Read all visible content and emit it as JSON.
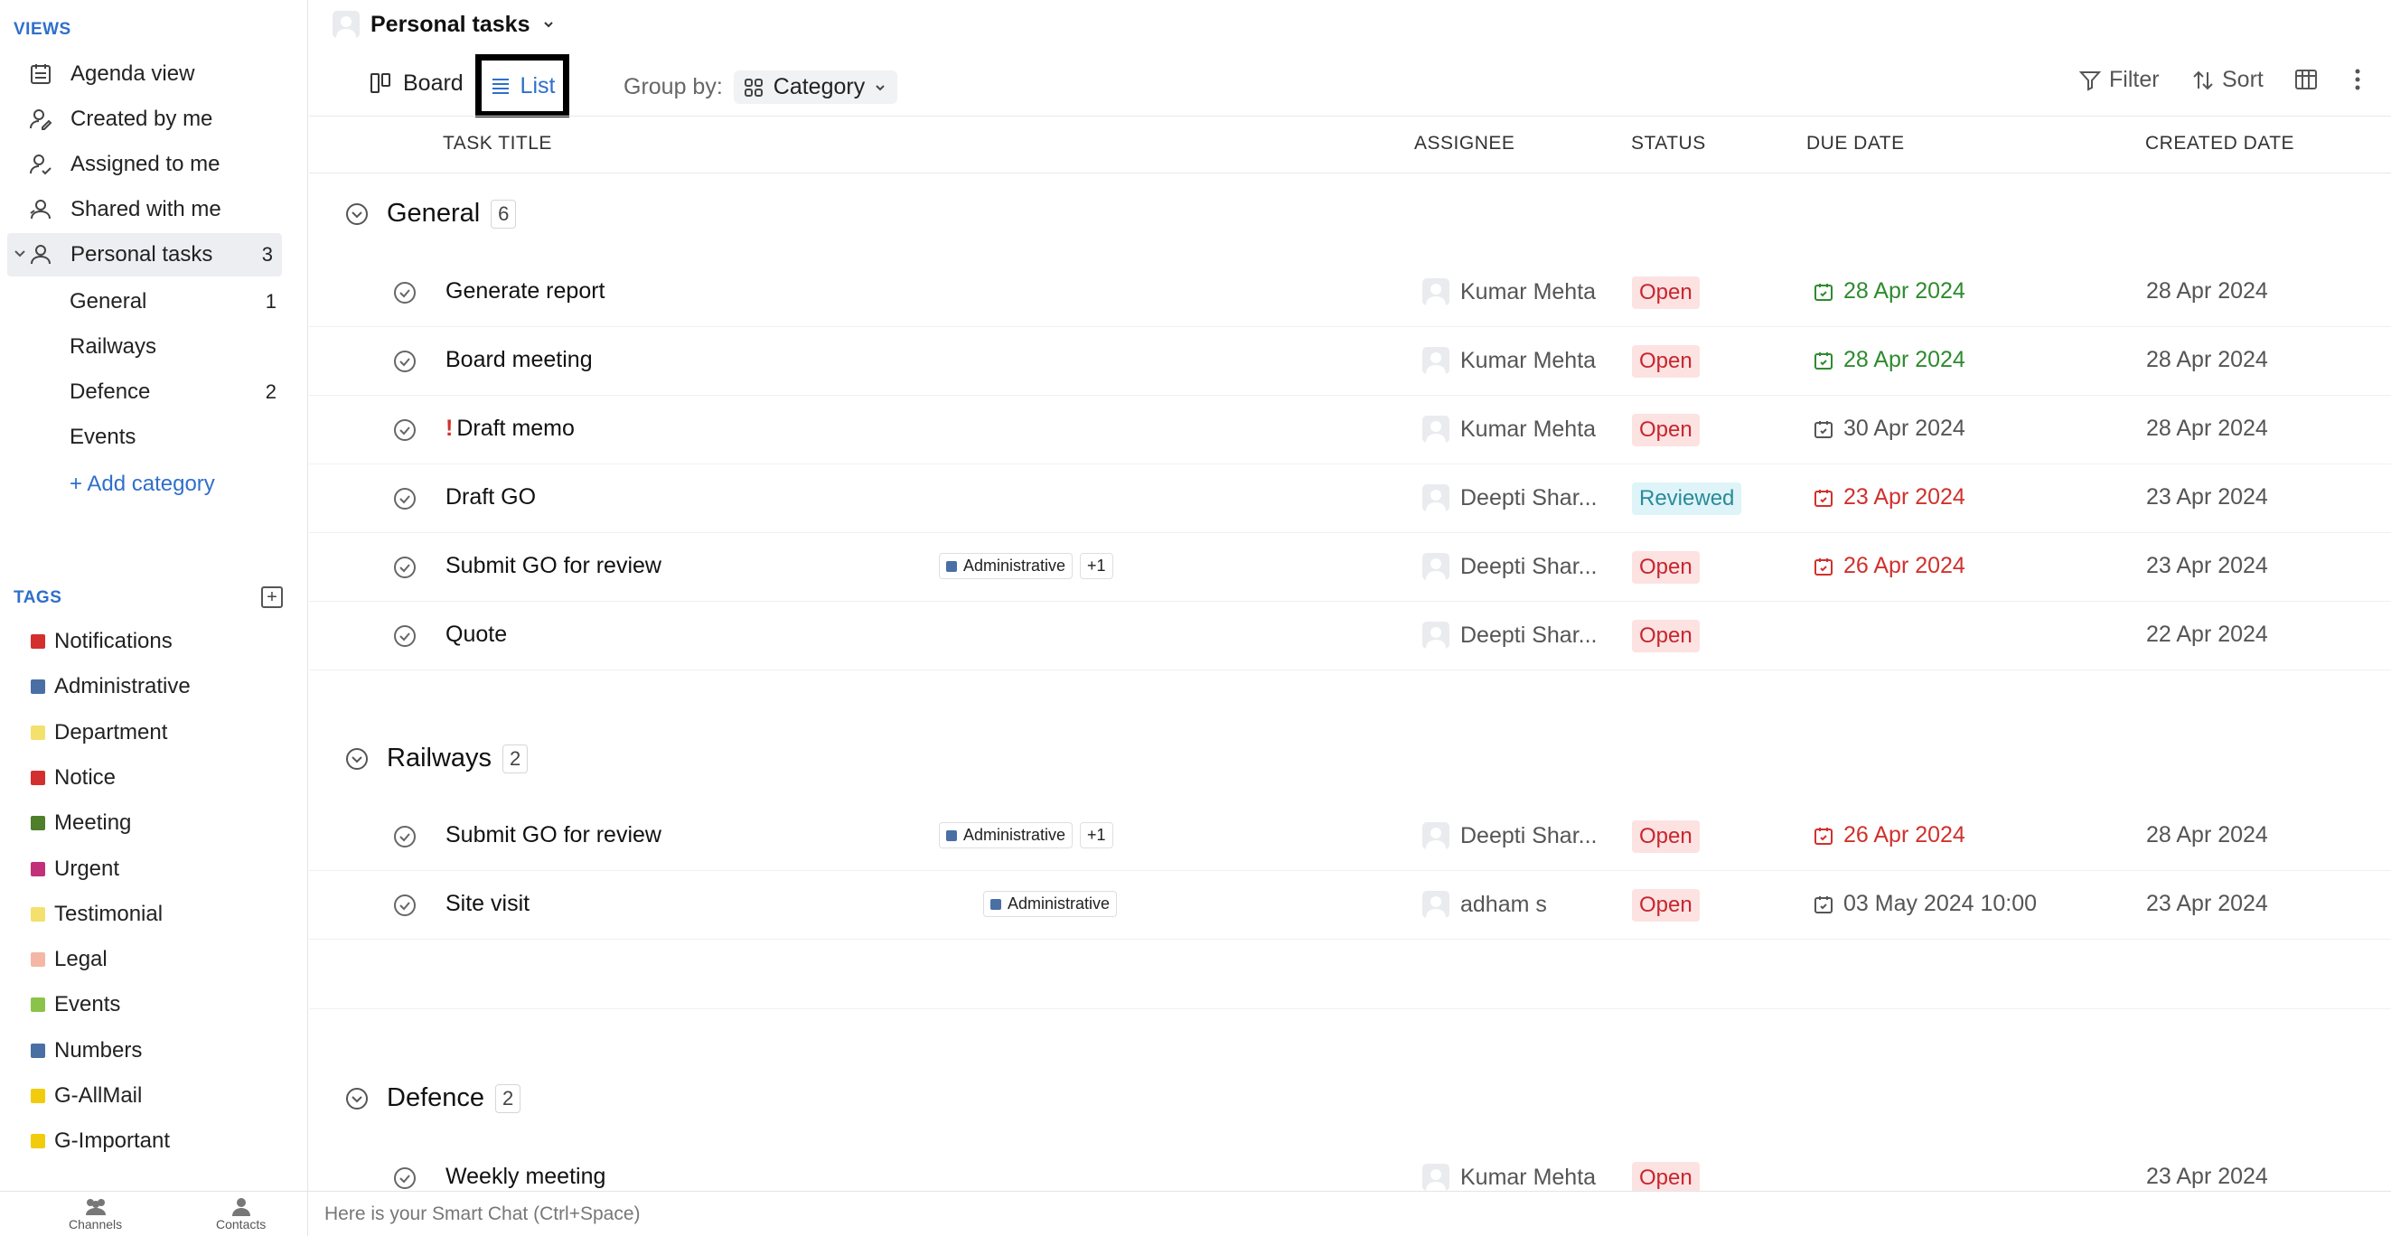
{
  "sidebar": {
    "views_title": "VIEWS",
    "views": [
      {
        "label": "Agenda view",
        "icon": "calendar-list-icon"
      },
      {
        "label": "Created by me",
        "icon": "user-edit-icon"
      },
      {
        "label": "Assigned to me",
        "icon": "user-check-icon"
      },
      {
        "label": "Shared with me",
        "icon": "user-share-icon"
      },
      {
        "label": "Personal tasks",
        "icon": "user-icon",
        "count": "3"
      }
    ],
    "categories": [
      {
        "label": "General",
        "count": "1"
      },
      {
        "label": "Railways",
        "count": ""
      },
      {
        "label": "Defence",
        "count": "2"
      },
      {
        "label": "Events",
        "count": ""
      }
    ],
    "add_category": "+ Add category",
    "tags_title": "TAGS",
    "tags": [
      {
        "label": "Notifications",
        "color": "#d32f2f"
      },
      {
        "label": "Administrative",
        "color": "#4a6fa5"
      },
      {
        "label": "Department",
        "color": "#f4e06d"
      },
      {
        "label": "Notice",
        "color": "#d32f2f"
      },
      {
        "label": "Meeting",
        "color": "#4f7f2a"
      },
      {
        "label": "Urgent",
        "color": "#c2307a"
      },
      {
        "label": "Testimonial",
        "color": "#f4e06d"
      },
      {
        "label": "Legal",
        "color": "#f4b7a6"
      },
      {
        "label": "Events",
        "color": "#8bc34a"
      },
      {
        "label": "Numbers",
        "color": "#4a6fa5"
      },
      {
        "label": "G-AllMail",
        "color": "#f2cc0c"
      },
      {
        "label": "G-Important",
        "color": "#f2cc0c"
      }
    ]
  },
  "bottom": {
    "channels": "Channels",
    "contacts": "Contacts",
    "smart_chat_placeholder": "Here is your Smart Chat (Ctrl+Space)"
  },
  "header": {
    "title": "Personal tasks",
    "board": "Board",
    "list": "List",
    "group_by_label": "Group by:",
    "group_by_value": "Category",
    "filter": "Filter",
    "sort": "Sort"
  },
  "columns": {
    "title": "TASK TITLE",
    "assignee": "ASSIGNEE",
    "status": "STATUS",
    "due": "DUE DATE",
    "created": "CREATED DATE"
  },
  "groups": [
    {
      "name": "General",
      "count": "6"
    },
    {
      "name": "Railways",
      "count": "2"
    },
    {
      "name": "Defence",
      "count": "2"
    }
  ],
  "tasks": [
    {
      "title": "Generate report",
      "assignee": "Kumar Mehta",
      "status": "Open",
      "due": "28 Apr 2024",
      "created": "28 Apr 2024"
    },
    {
      "title": "Board meeting",
      "assignee": "Kumar Mehta",
      "status": "Open",
      "due": "28 Apr 2024",
      "created": "28 Apr 2024"
    },
    {
      "title": "Draft memo",
      "priority": "!",
      "assignee": "Kumar Mehta",
      "status": "Open",
      "due": "30 Apr 2024",
      "created": "28 Apr 2024"
    },
    {
      "title": "Draft GO",
      "assignee": "Deepti Shar...",
      "status": "Reviewed",
      "due": "23 Apr 2024",
      "created": "23 Apr 2024"
    },
    {
      "title": "Submit GO for review",
      "tag": "Administrative",
      "more_tags": "+1",
      "assignee": "Deepti Shar...",
      "status": "Open",
      "due": "26 Apr 2024",
      "created": "23 Apr 2024"
    },
    {
      "title": "Quote",
      "assignee": "Deepti Shar...",
      "status": "Open",
      "due": "",
      "created": "22 Apr 2024"
    },
    {
      "title": "Submit GO for review",
      "tag": "Administrative",
      "more_tags": "+1",
      "assignee": "Deepti Shar...",
      "status": "Open",
      "due": "26 Apr 2024",
      "created": "28 Apr 2024"
    },
    {
      "title": "Site visit",
      "tag": "Administrative",
      "assignee": "adham s",
      "status": "Open",
      "due": "03 May 2024 10:00",
      "created": "23 Apr 2024"
    },
    {
      "title": "Weekly meeting",
      "assignee": "Kumar Mehta",
      "status": "Open",
      "due": "",
      "created": "23 Apr 2024"
    }
  ],
  "colors": {
    "accent": "#2f6fcb",
    "due_overdue": "#d0312d",
    "due_today": "#2e8b2e",
    "status_open_bg": "#fde2e2",
    "status_reviewed_bg": "#def4f8"
  }
}
